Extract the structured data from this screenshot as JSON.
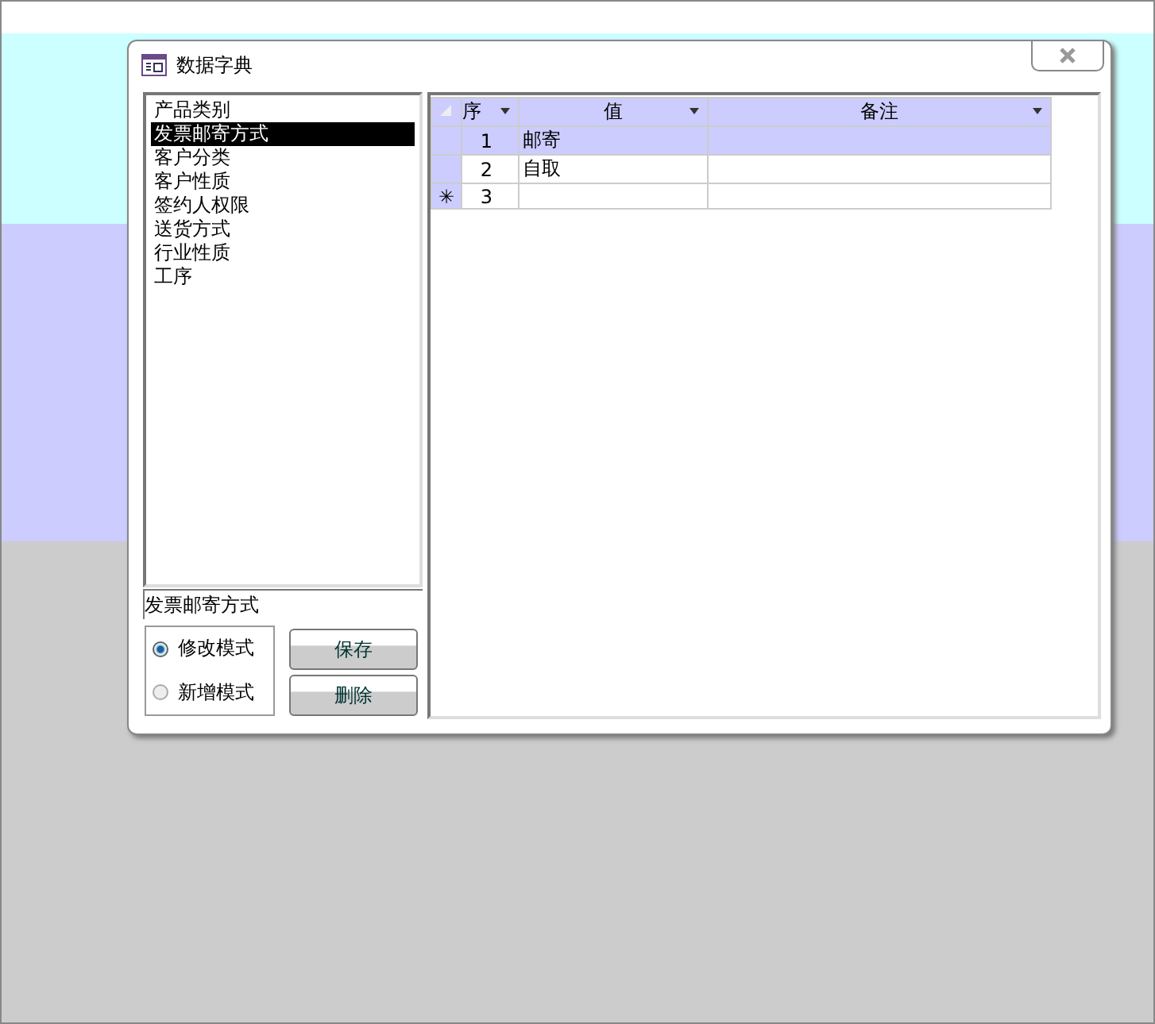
{
  "window": {
    "title": "数据字典"
  },
  "list": {
    "items": [
      {
        "label": "产品类别",
        "selected": false
      },
      {
        "label": "发票邮寄方式",
        "selected": true
      },
      {
        "label": "客户分类",
        "selected": false
      },
      {
        "label": "客户性质",
        "selected": false
      },
      {
        "label": "签约人权限",
        "selected": false
      },
      {
        "label": "送货方式",
        "selected": false
      },
      {
        "label": "行业性质",
        "selected": false
      },
      {
        "label": "工序",
        "selected": false
      }
    ]
  },
  "current": {
    "value": "发票邮寄方式"
  },
  "modes": [
    {
      "label": "修改模式",
      "selected": true
    },
    {
      "label": "新增模式",
      "selected": false
    }
  ],
  "buttons": [
    "保存",
    "删除"
  ],
  "table": {
    "columns": [
      "序",
      "值",
      "备注"
    ],
    "rows": [
      {
        "kind": "record",
        "selected": true,
        "cells": [
          "1",
          "邮寄",
          ""
        ]
      },
      {
        "kind": "record",
        "selected": false,
        "cells": [
          "2",
          "自取",
          ""
        ]
      },
      {
        "kind": "new",
        "selected": false,
        "marker": "✳",
        "cells": [
          "3",
          "",
          ""
        ]
      }
    ]
  }
}
